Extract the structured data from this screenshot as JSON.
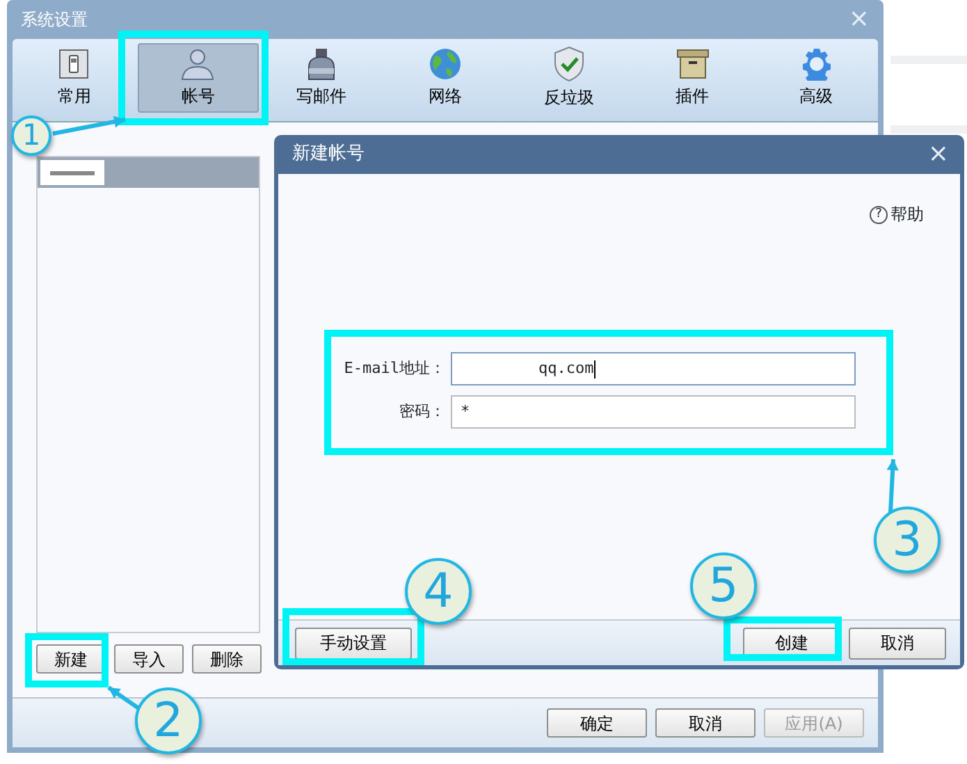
{
  "window": {
    "title": "系统设置",
    "close": "×"
  },
  "tabs": [
    {
      "label": "常用",
      "selected": false
    },
    {
      "label": "帐号",
      "selected": true
    },
    {
      "label": "写邮件",
      "selected": false
    },
    {
      "label": "网络",
      "selected": false
    },
    {
      "label": "反垃圾",
      "selected": false
    },
    {
      "label": "插件",
      "selected": false
    },
    {
      "label": "高级",
      "selected": false
    }
  ],
  "account_list": {
    "rows": [
      {
        "selected": true
      }
    ]
  },
  "account_buttons": [
    "新建",
    "导入",
    "删除"
  ],
  "footer_buttons": [
    {
      "label": "确定",
      "disabled": false
    },
    {
      "label": "取消",
      "disabled": false
    },
    {
      "label": "应用(A)",
      "disabled": true
    }
  ],
  "dialog": {
    "title": "新建帐号",
    "close": "×",
    "help_icon": "?",
    "help": "帮助",
    "fields": [
      {
        "label": "E-mail地址：",
        "value": "qq.com",
        "focused": true
      },
      {
        "label": "密码：",
        "value": "*",
        "focused": false
      }
    ],
    "manual_button": "手动设置",
    "buttons": [
      "创建",
      "取消"
    ]
  },
  "annotations": [
    {
      "number": "1"
    },
    {
      "number": "2"
    },
    {
      "number": "3"
    },
    {
      "number": "4"
    },
    {
      "number": "5"
    }
  ]
}
